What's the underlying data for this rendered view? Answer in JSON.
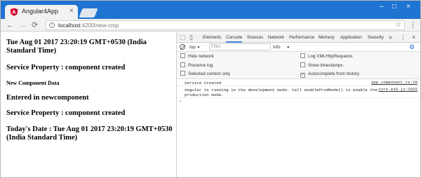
{
  "browser": {
    "tab_title": "Angular4App",
    "tab_close": "×",
    "window_buttons": [
      "–",
      "□",
      "×"
    ],
    "nav": {
      "back": "←",
      "forward": "→",
      "reload": "⟳"
    },
    "url_host": "localhost",
    "url_path": ":4200/new-cmp",
    "star": "☆",
    "menu": "⋮",
    "info": "i",
    "accent_color": "#1f74d1"
  },
  "page": {
    "lines": [
      "Tue Aug 01 2017 23:20:19 GMT+0530 (India Standard Time)",
      "Service Property : component created",
      "New Component Data",
      "Entered in newcomponent",
      "Service Property : component created",
      "Today's Date : Tue Aug 01 2017 23:20:19 GMT+0530 (India Standard Time)"
    ]
  },
  "devtools": {
    "icons": {
      "inspect": "⬚",
      "device": "▯",
      "more_tabs": "»",
      "close": "×",
      "gear": "⚙"
    },
    "tabs": [
      "Elements",
      "Console",
      "Sources",
      "Network",
      "Performance",
      "Memory",
      "Application",
      "Security"
    ],
    "active_tab": "Console",
    "active_color": "#3879d9",
    "context": "top",
    "context_arrow": "▼",
    "filter_placeholder": "Filter",
    "levels": "Info",
    "levels_arrow": "▼",
    "settings": {
      "hide_network": "Hide network",
      "preserve_log": "Preserve log",
      "selected_context": "Selected context only",
      "log_xhr": "Log XMLHttpRequests",
      "show_timestamps": "Show timestamps",
      "autocomplete": "Autocomplete from history",
      "checkmark": "✓"
    },
    "messages": [
      {
        "text": "Service Created",
        "source": "app.component.ts:20"
      },
      {
        "text": "Angular is running in the development mode. Call enableProdMode() to enable the\nproduction mode.",
        "source": "core.es5.js:2925"
      }
    ],
    "prompt": "›"
  }
}
